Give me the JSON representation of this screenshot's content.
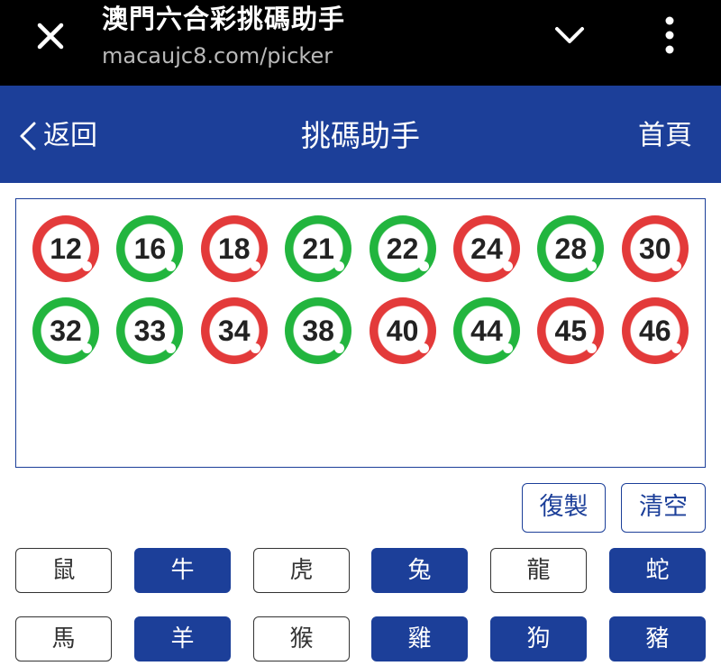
{
  "browser": {
    "title": "澳門六合彩挑碼助手",
    "url": "macaujc8.com/picker",
    "close_icon": "close-icon",
    "chevron_icon": "chevron-down-icon",
    "more_icon": "more-vertical-icon"
  },
  "header": {
    "back_label": "返回",
    "title": "挑碼助手",
    "home_label": "首頁"
  },
  "picked_numbers": [
    {
      "number": "12",
      "color": "red"
    },
    {
      "number": "16",
      "color": "green"
    },
    {
      "number": "18",
      "color": "red"
    },
    {
      "number": "21",
      "color": "green"
    },
    {
      "number": "22",
      "color": "green"
    },
    {
      "number": "24",
      "color": "red"
    },
    {
      "number": "28",
      "color": "green"
    },
    {
      "number": "30",
      "color": "red"
    },
    {
      "number": "32",
      "color": "green"
    },
    {
      "number": "33",
      "color": "green"
    },
    {
      "number": "34",
      "color": "red"
    },
    {
      "number": "38",
      "color": "green"
    },
    {
      "number": "40",
      "color": "red"
    },
    {
      "number": "44",
      "color": "green"
    },
    {
      "number": "45",
      "color": "red"
    },
    {
      "number": "46",
      "color": "red"
    }
  ],
  "actions": {
    "copy_label": "復製",
    "clear_label": "清空"
  },
  "zodiac": [
    {
      "label": "鼠",
      "selected": false
    },
    {
      "label": "牛",
      "selected": true
    },
    {
      "label": "虎",
      "selected": false
    },
    {
      "label": "兔",
      "selected": true
    },
    {
      "label": "龍",
      "selected": false
    },
    {
      "label": "蛇",
      "selected": true
    },
    {
      "label": "馬",
      "selected": false
    },
    {
      "label": "羊",
      "selected": true
    },
    {
      "label": "猴",
      "selected": false
    },
    {
      "label": "雞",
      "selected": true
    },
    {
      "label": "狗",
      "selected": true
    },
    {
      "label": "豬",
      "selected": true
    }
  ],
  "colors": {
    "brand_blue": "#1c3f99",
    "ball_red": "#e33a3a",
    "ball_green": "#22b53e"
  }
}
